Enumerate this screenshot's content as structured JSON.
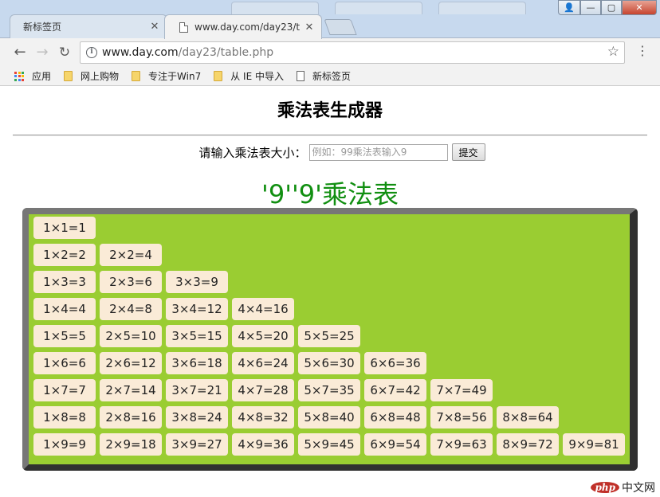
{
  "browser": {
    "background_tabs": [
      "",
      "",
      ""
    ],
    "tabs": [
      {
        "title": "新标签页",
        "close": "✕"
      },
      {
        "title": "www.day.com/day23/t",
        "close": "✕"
      }
    ],
    "window_controls": {
      "user": "👤",
      "minimize": "—",
      "maximize": "▢",
      "close": "✕"
    },
    "nav": {
      "back": "←",
      "forward": "→",
      "reload": "↻"
    },
    "address": {
      "host": "www.day.com",
      "path": "/day23/table.php"
    },
    "bookmarks": [
      {
        "label": "应用",
        "icon": "apps-icon"
      },
      {
        "label": "网上购物",
        "icon": "folder-icon"
      },
      {
        "label": "专注于Win7",
        "icon": "folder-icon"
      },
      {
        "label": "从 IE 中导入",
        "icon": "folder-icon"
      },
      {
        "label": "新标签页",
        "icon": "document-icon"
      }
    ],
    "colors": {
      "apps_grid": [
        "#ea4335",
        "#fbbc05",
        "#34a853",
        "#4285f4",
        "#ea4335",
        "#fbbc05",
        "#34a853",
        "#4285f4",
        "#ea4335"
      ]
    }
  },
  "page": {
    "title": "乘法表生成器",
    "form": {
      "label": "请输入乘法表大小：",
      "placeholder": "例如：99乘法表输入9",
      "value": "",
      "submit": "提交"
    },
    "table_heading": "'9''9'乘法表",
    "table_rows": [
      [
        "1×1=1"
      ],
      [
        "1×2=2",
        "2×2=4"
      ],
      [
        "1×3=3",
        "2×3=6",
        "3×3=9"
      ],
      [
        "1×4=4",
        "2×4=8",
        "3×4=12",
        "4×4=16"
      ],
      [
        "1×5=5",
        "2×5=10",
        "3×5=15",
        "4×5=20",
        "5×5=25"
      ],
      [
        "1×6=6",
        "2×6=12",
        "3×6=18",
        "4×6=24",
        "5×6=30",
        "6×6=36"
      ],
      [
        "1×7=7",
        "2×7=14",
        "3×7=21",
        "4×7=28",
        "5×7=35",
        "6×7=42",
        "7×7=49"
      ],
      [
        "1×8=8",
        "2×8=16",
        "3×8=24",
        "4×8=32",
        "5×8=40",
        "6×8=48",
        "7×8=56",
        "8×8=64"
      ],
      [
        "1×9=9",
        "2×9=18",
        "3×9=27",
        "4×9=36",
        "5×9=45",
        "6×9=54",
        "7×9=63",
        "8×9=72",
        "9×9=81"
      ]
    ],
    "colors": {
      "heading": "#118f11",
      "table_bg": "#9acd32",
      "cell_bg": "#faebd7"
    }
  },
  "watermark": {
    "badge": "php",
    "text": "中文网"
  }
}
